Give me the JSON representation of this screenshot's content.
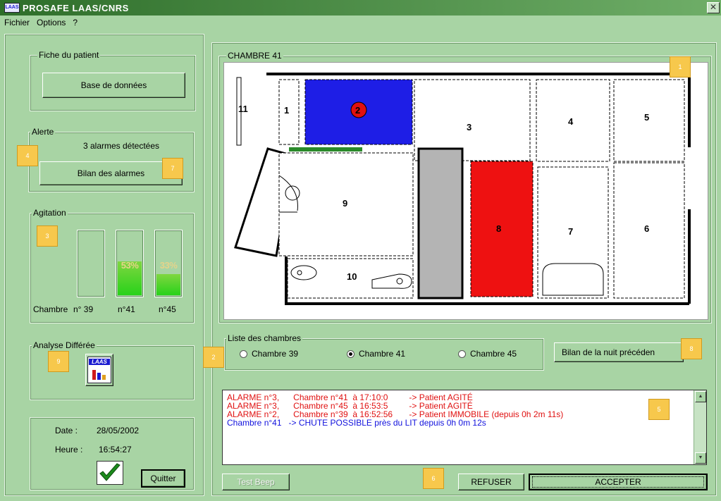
{
  "window": {
    "title": "PROSAFE  LAAS/CNRS",
    "icon_text": "LAAS"
  },
  "menu": [
    "Fichier",
    "Options",
    "?"
  ],
  "patient": {
    "legend": "Fiche du patient",
    "db_button": "Base de données"
  },
  "alert": {
    "legend": "Alerte",
    "status": "3 alarmes détectées",
    "button": "Bilan des alarmes"
  },
  "agitation": {
    "legend": "Agitation",
    "prefix_label": "Chambre",
    "bars": [
      {
        "label": "n° 39",
        "pct": 0,
        "pct_text": ""
      },
      {
        "label": "n°41",
        "pct": 0.53,
        "pct_text": "53%"
      },
      {
        "label": "n°45",
        "pct": 0.33,
        "pct_text": "33%"
      }
    ]
  },
  "deferred": {
    "legend": "Analyse Différée",
    "icon_text": "LAAS"
  },
  "datetime": {
    "date_label": "Date :",
    "date": "28/05/2002",
    "time_label": "Heure :",
    "time": "16:54:27",
    "quit_button": "Quitter"
  },
  "room": {
    "legend": "CHAMBRE 41",
    "zones": [
      "11",
      "1",
      "2",
      "3",
      "4",
      "5",
      "9",
      "8",
      "7",
      "6",
      "10"
    ],
    "colors": {
      "zone2": "#1e1ee6",
      "zone8": "#ee1111",
      "corridor": "#b4b4b4",
      "door": "#2a8a2a",
      "alarm_dot": "#e01010"
    }
  },
  "rooms_list": {
    "legend": "Liste des chambres",
    "options": [
      {
        "label": "Chambre 39",
        "checked": false
      },
      {
        "label": "Chambre 41",
        "checked": true
      },
      {
        "label": "Chambre 45",
        "checked": false
      }
    ],
    "summary_button": "Bilan de la nuit précéden"
  },
  "log": [
    {
      "text": "ALARME n°3,      Chambre n°41  à 17:10:0         -> Patient AGITÉ",
      "color": "#e01010"
    },
    {
      "text": "ALARME n°3,      Chambre n°45  à 16:53:5         -> Patient AGITÉ",
      "color": "#e01010"
    },
    {
      "text": "ALARME n°2,      Chambre n°39  à 16:52:56       -> Patient IMMOBILE (depuis 0h 2m 11s)",
      "color": "#e01010"
    },
    {
      "text": "Chambre n°41   -> CHUTE POSSIBLE près du LIT depuis 0h 0m 12s",
      "color": "#1111dd"
    }
  ],
  "buttons": {
    "test_beep": "Test Beep",
    "refuse": "REFUSER",
    "accept": "ACCEPTER"
  },
  "markers": [
    "1",
    "2",
    "3",
    "4",
    "5",
    "6",
    "7",
    "8",
    "9"
  ]
}
